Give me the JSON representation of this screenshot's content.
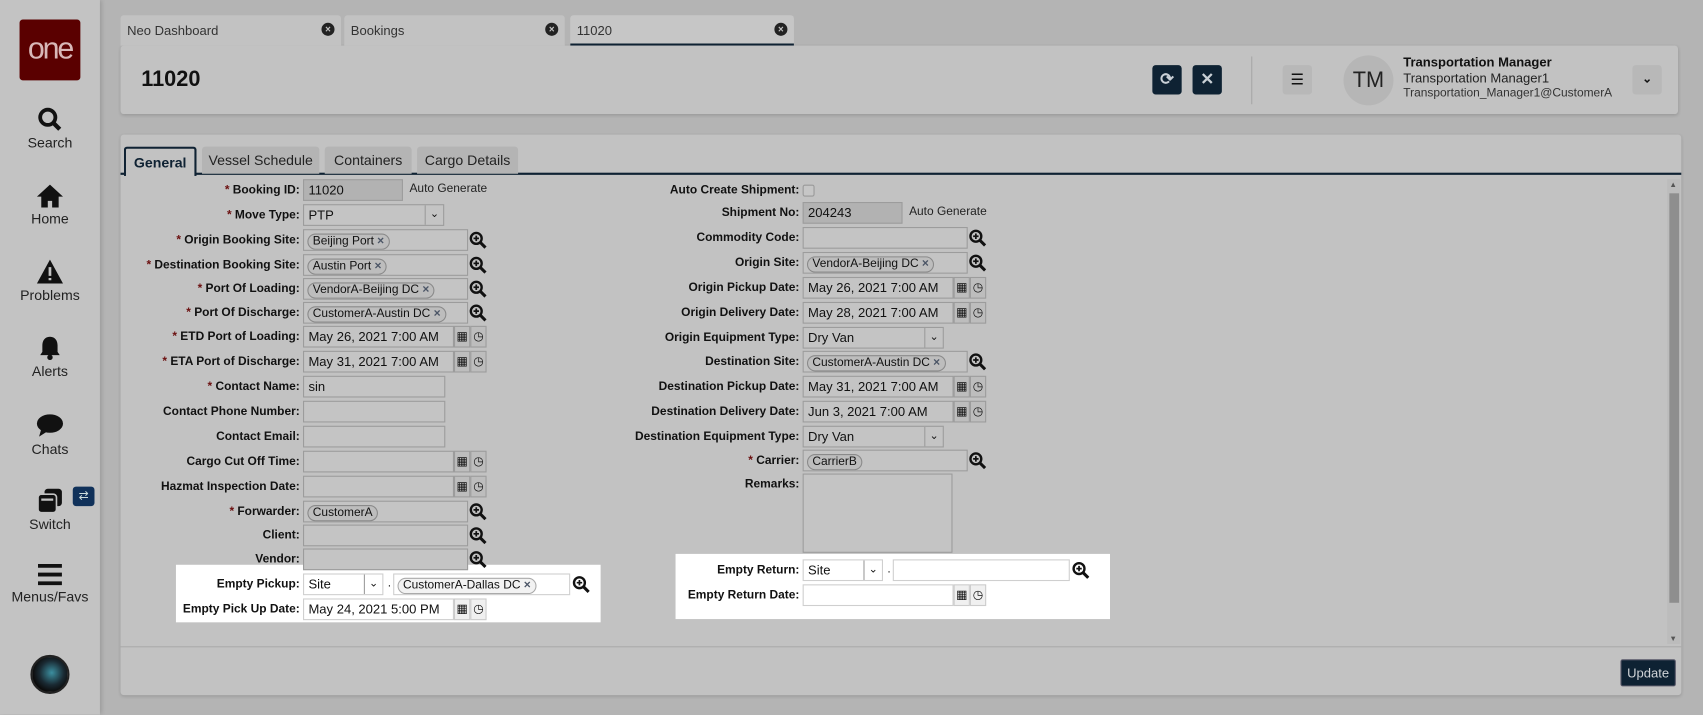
{
  "sidebar": {
    "logo": "one",
    "items": [
      {
        "label": "Search",
        "icon": "search-icon"
      },
      {
        "label": "Home",
        "icon": "home-icon"
      },
      {
        "label": "Problems",
        "icon": "warning-icon"
      },
      {
        "label": "Alerts",
        "icon": "bell-icon"
      },
      {
        "label": "Chats",
        "icon": "chat-icon"
      },
      {
        "label": "Switch",
        "icon": "switch-icon"
      },
      {
        "label": "Menus/Favs",
        "icon": "menu-icon"
      }
    ]
  },
  "tabs": [
    {
      "label": "Neo Dashboard"
    },
    {
      "label": "Bookings"
    },
    {
      "label": "11020",
      "active": true
    }
  ],
  "header": {
    "title": "11020",
    "user": {
      "initials": "TM",
      "role": "Transportation Manager",
      "name": "Transportation Manager1",
      "email": "Transportation_Manager1@CustomerA"
    }
  },
  "form_tabs": [
    {
      "label": "General"
    },
    {
      "label": "Vessel Schedule"
    },
    {
      "label": "Containers"
    },
    {
      "label": "Cargo Details"
    }
  ],
  "left_fields": [
    {
      "label": "Booking ID:",
      "req": true,
      "type": "readonly",
      "value": "11020",
      "note": "Auto Generate"
    },
    {
      "label": "Move Type:",
      "req": true,
      "type": "select",
      "value": "PTP"
    },
    {
      "label": "Origin Booking Site:",
      "req": true,
      "type": "lookup",
      "chips": [
        "Beijing Port"
      ]
    },
    {
      "label": "Destination Booking Site:",
      "req": true,
      "type": "lookup",
      "chips": [
        "Austin Port"
      ]
    },
    {
      "label": "Port Of Loading:",
      "req": true,
      "type": "lookup",
      "chips": [
        "VendorA-Beijing DC"
      ]
    },
    {
      "label": "Port Of Discharge:",
      "req": true,
      "type": "lookup",
      "chips": [
        "CustomerA-Austin DC"
      ]
    },
    {
      "label": "ETD Port of Loading:",
      "req": true,
      "type": "date",
      "value": "May 26, 2021 7:00 AM"
    },
    {
      "label": "ETA Port of Discharge:",
      "req": true,
      "type": "date",
      "value": "May 31, 2021 7:00 AM"
    },
    {
      "label": "Contact Name:",
      "req": true,
      "type": "text",
      "value": "sin"
    },
    {
      "label": "Contact Phone Number:",
      "type": "text",
      "value": ""
    },
    {
      "label": "Contact Email:",
      "type": "text",
      "value": ""
    },
    {
      "label": "Cargo Cut Off Time:",
      "type": "date",
      "value": ""
    },
    {
      "label": "Hazmat Inspection Date:",
      "type": "date",
      "value": ""
    },
    {
      "label": "Forwarder:",
      "req": true,
      "type": "lookup",
      "chips": [
        "CustomerA"
      ],
      "readonlychip": true
    },
    {
      "label": "Client:",
      "type": "lookup",
      "chips": []
    },
    {
      "label": "Vendor:",
      "type": "lookup",
      "chips": []
    },
    {
      "label": "Empty Pickup:",
      "type": "pair",
      "value": "Site",
      "chips": [
        "CustomerA-Dallas DC"
      ]
    },
    {
      "label": "Empty Pick Up Date:",
      "type": "date",
      "value": "May 24, 2021 5:00 PM"
    }
  ],
  "right_fields": [
    {
      "label": "Auto Create Shipment:",
      "type": "checkbox"
    },
    {
      "label": "Shipment No:",
      "type": "readonly",
      "value": "204243",
      "note": "Auto Generate"
    },
    {
      "label": "Commodity Code:",
      "type": "lookup",
      "chips": []
    },
    {
      "label": "Origin Site:",
      "type": "lookup",
      "chips": [
        "VendorA-Beijing DC"
      ]
    },
    {
      "label": "Origin Pickup Date:",
      "type": "date",
      "value": "May 26, 2021 7:00 AM"
    },
    {
      "label": "Origin Delivery Date:",
      "type": "date",
      "value": "May 28, 2021 7:00 AM"
    },
    {
      "label": "Origin Equipment Type:",
      "type": "select",
      "value": "Dry Van"
    },
    {
      "label": "Destination Site:",
      "type": "lookup",
      "chips": [
        "CustomerA-Austin DC"
      ]
    },
    {
      "label": "Destination Pickup Date:",
      "type": "date",
      "value": "May 31, 2021 7:00 AM"
    },
    {
      "label": "Destination Delivery Date:",
      "type": "date",
      "value": "Jun 3, 2021 7:00 AM"
    },
    {
      "label": "Destination Equipment Type:",
      "type": "select",
      "value": "Dry Van"
    },
    {
      "label": "Carrier:",
      "req": true,
      "type": "lookup",
      "chips": [
        "CarrierB"
      ],
      "readonlychip": true
    },
    {
      "label": "Remarks:",
      "type": "textarea",
      "value": ""
    },
    {
      "label": "Empty Return:",
      "type": "pair",
      "value": "Site",
      "chips": []
    },
    {
      "label": "Empty Return Date:",
      "type": "date",
      "value": ""
    }
  ],
  "footer": {
    "update_label": "Update"
  }
}
